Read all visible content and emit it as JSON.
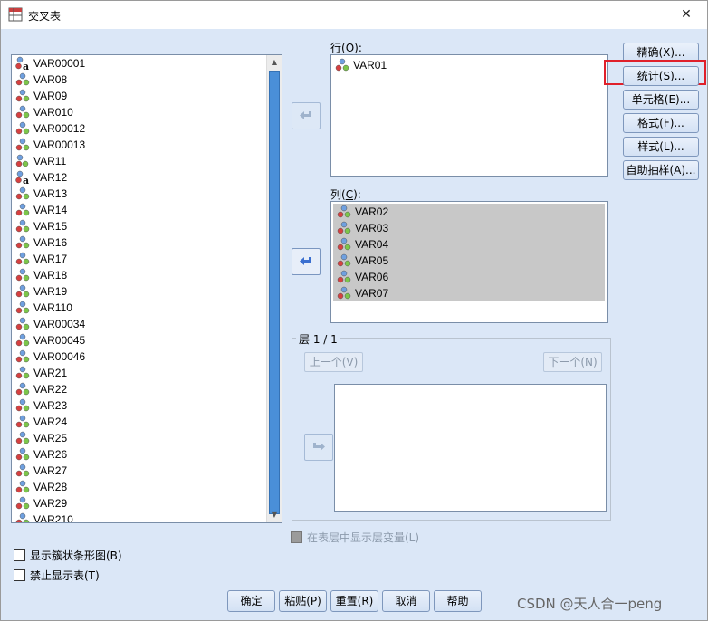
{
  "window": {
    "title": "交叉表",
    "close_glyph": "✕"
  },
  "source_variables": [
    {
      "name": "VAR00001",
      "type": "string"
    },
    {
      "name": "VAR08",
      "type": "scale"
    },
    {
      "name": "VAR09",
      "type": "scale"
    },
    {
      "name": "VAR010",
      "type": "scale"
    },
    {
      "name": "VAR00012",
      "type": "scale"
    },
    {
      "name": "VAR00013",
      "type": "scale"
    },
    {
      "name": "VAR11",
      "type": "nominal"
    },
    {
      "name": "VAR12",
      "type": "string"
    },
    {
      "name": "VAR13",
      "type": "scale"
    },
    {
      "name": "VAR14",
      "type": "scale"
    },
    {
      "name": "VAR15",
      "type": "scale"
    },
    {
      "name": "VAR16",
      "type": "scale"
    },
    {
      "name": "VAR17",
      "type": "scale"
    },
    {
      "name": "VAR18",
      "type": "scale"
    },
    {
      "name": "VAR19",
      "type": "scale"
    },
    {
      "name": "VAR110",
      "type": "scale"
    },
    {
      "name": "VAR00034",
      "type": "scale"
    },
    {
      "name": "VAR00045",
      "type": "scale"
    },
    {
      "name": "VAR00046",
      "type": "scale"
    },
    {
      "name": "VAR21",
      "type": "scale"
    },
    {
      "name": "VAR22",
      "type": "scale"
    },
    {
      "name": "VAR23",
      "type": "scale"
    },
    {
      "name": "VAR24",
      "type": "scale"
    },
    {
      "name": "VAR25",
      "type": "scale"
    },
    {
      "name": "VAR26",
      "type": "scale"
    },
    {
      "name": "VAR27",
      "type": "scale"
    },
    {
      "name": "VAR28",
      "type": "scale"
    },
    {
      "name": "VAR29",
      "type": "scale"
    },
    {
      "name": "VAR210",
      "type": "scale"
    }
  ],
  "rows": {
    "label": "行(",
    "key": "O",
    "suffix": "):",
    "items": [
      "VAR01"
    ]
  },
  "columns": {
    "label": "列(",
    "key": "C",
    "suffix": "):",
    "items": [
      "VAR02",
      "VAR03",
      "VAR04",
      "VAR05",
      "VAR06",
      "VAR07"
    ]
  },
  "layer": {
    "label": "层 1 / 1",
    "prev_label": "上一个(V)",
    "next_label": "下一个(N)"
  },
  "side_buttons": {
    "exact": "精确(X)...",
    "statistics": "统计(S)...",
    "cells": "单元格(E)...",
    "format": "格式(F)...",
    "style": "样式(L)...",
    "bootstrap": "自助抽样(A)..."
  },
  "options": {
    "show_layer_vars": "在表层中显示层变量(L)",
    "clustered_bar": "显示簇状条形图(B)",
    "suppress_tables": "禁止显示表(T)"
  },
  "bottom_buttons": {
    "ok": "确定",
    "paste": "粘贴(P)",
    "reset": "重置(R)",
    "cancel": "取消",
    "help": "帮助"
  },
  "watermark": "CSDN @天人合一peng",
  "colors": {
    "accent": "#4a8fd8",
    "highlight": "#e0202a",
    "client_bg": "#dbe7f7"
  }
}
